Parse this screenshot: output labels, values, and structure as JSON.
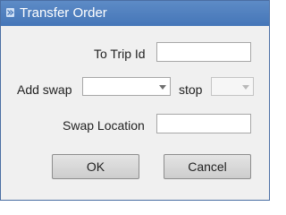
{
  "window": {
    "title": "Transfer Order",
    "icon": "app-icon"
  },
  "form": {
    "to_trip_id_label": "To Trip Id",
    "to_trip_id_value": "",
    "add_swap_label": "Add swap",
    "add_swap_value": "",
    "stop_label": "stop",
    "stop_value": "",
    "swap_location_label": "Swap Location",
    "swap_location_value": ""
  },
  "buttons": {
    "ok": "OK",
    "cancel": "Cancel"
  }
}
